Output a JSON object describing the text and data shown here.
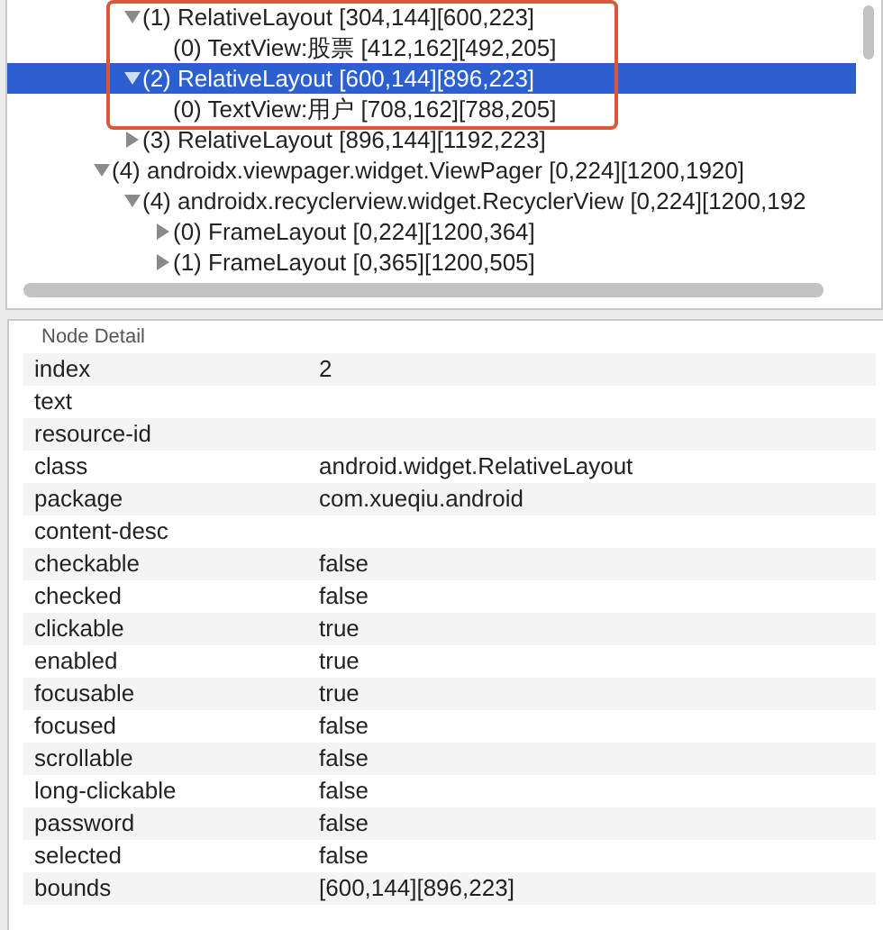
{
  "tree": {
    "nodes": [
      {
        "children": [
          {
            "label": "(1) RelativeLayout [304,144][600,223]",
            "expanded": true,
            "selected": false,
            "children": [
              {
                "label": "(0) TextView:股票 [412,162][492,205]",
                "selected": false
              }
            ]
          },
          {
            "label": "(2) RelativeLayout [600,144][896,223]",
            "expanded": true,
            "selected": true,
            "children": [
              {
                "label": "(0) TextView:用户 [708,162][788,205]",
                "selected": false
              }
            ]
          },
          {
            "label": "(3) RelativeLayout [896,144][1192,223]",
            "expanded": false,
            "selected": false
          }
        ]
      },
      {
        "label": "(4) androidx.viewpager.widget.ViewPager [0,224][1200,1920]",
        "expanded": true,
        "selected": false,
        "children": [
          {
            "label": "(4) androidx.recyclerview.widget.RecyclerView [0,224][1200,192",
            "expanded": true,
            "selected": false,
            "children": [
              {
                "label": "(0) FrameLayout [0,224][1200,364]",
                "expanded": false,
                "selected": false
              },
              {
                "label": "(1) FrameLayout [0,365][1200,505]",
                "expanded": false,
                "selected": false
              }
            ]
          }
        ]
      }
    ]
  },
  "node_detail": {
    "title": "Node Detail",
    "rows": [
      {
        "key": "index",
        "value": "2"
      },
      {
        "key": "text"
      },
      {
        "key": "resource-id"
      },
      {
        "key": "class",
        "value": "android.widget.RelativeLayout"
      },
      {
        "key": "package",
        "value": "com.xueqiu.android"
      },
      {
        "key": "content-desc"
      },
      {
        "key": "checkable",
        "value": "false"
      },
      {
        "key": "checked",
        "value": "false"
      },
      {
        "key": "clickable",
        "value": "true"
      },
      {
        "key": "enabled",
        "value": "true"
      },
      {
        "key": "focusable",
        "value": "true"
      },
      {
        "key": "focused",
        "value": "false"
      },
      {
        "key": "scrollable",
        "value": "false"
      },
      {
        "key": "long-clickable",
        "value": "false"
      },
      {
        "key": "password",
        "value": "false"
      },
      {
        "key": "selected",
        "value": "false"
      },
      {
        "key": "bounds",
        "value": "[600,144][896,223]"
      }
    ]
  }
}
